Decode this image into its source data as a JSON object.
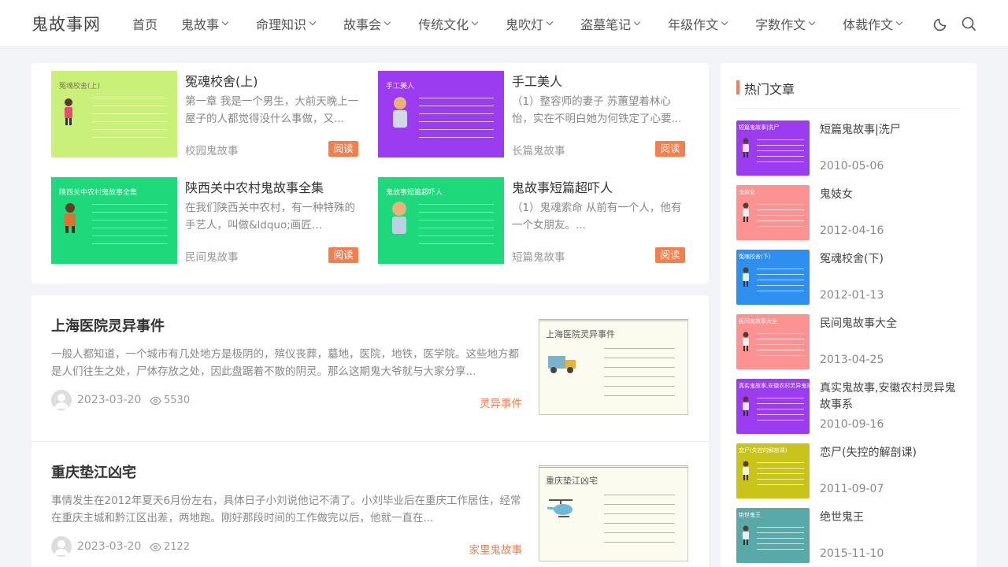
{
  "site": {
    "logo": "鬼故事网",
    "nav": [
      {
        "label": "首页",
        "dropdown": false
      },
      {
        "label": "鬼故事",
        "dropdown": true
      },
      {
        "label": "命理知识",
        "dropdown": true
      },
      {
        "label": "故事会",
        "dropdown": true
      },
      {
        "label": "传统文化",
        "dropdown": true
      },
      {
        "label": "鬼吹灯",
        "dropdown": true
      },
      {
        "label": "盗墓笔记",
        "dropdown": true
      },
      {
        "label": "年级作文",
        "dropdown": true
      },
      {
        "label": "字数作文",
        "dropdown": true
      },
      {
        "label": "体裁作文",
        "dropdown": true
      }
    ],
    "icons": {
      "theme": "moon-icon",
      "search": "search-icon"
    }
  },
  "featured": [
    {
      "thumb_title": "冤魂校舍(上)",
      "thumb_color": "#c9f17a",
      "title": "冤魂校舍(上)",
      "excerpt": "第一章 我是一个男生，大前天晚上一屋子的人都觉得没什么事做，又...",
      "category": "校园鬼故事",
      "read": "阅读"
    },
    {
      "thumb_title": "手工美人",
      "thumb_color": "#9b3cf1",
      "title": "手工美人",
      "excerpt": "（1）整容师的妻子 苏蕙望着林心怡，实在不明白她为何铁定了心要...",
      "category": "长篇鬼故事",
      "read": "阅读"
    },
    {
      "thumb_title": "陕西关中农村鬼故事全集",
      "thumb_color": "#1ed87c",
      "title": "陕西关中农村鬼故事全集",
      "excerpt": "在我们陕西关中农村，有一种特殊的手艺人，叫做&ldquo;画匠&rdquo;...",
      "category": "民间鬼故事",
      "read": "阅读"
    },
    {
      "thumb_title": "鬼故事短篇超吓人",
      "thumb_color": "#1ed87c",
      "title": "鬼故事短篇超吓人",
      "excerpt": "（1）鬼魂索命 从前有一个人，他有一个女朋友。...",
      "category": "短篇鬼故事",
      "read": "阅读"
    }
  ],
  "posts": [
    {
      "title": "上海医院灵异事件",
      "excerpt": "一般人都知道，一个城市有几处地方是极阴的，殡仪丧葬，墓地，医院，地铁，医学院。这些地方都是人们往生之处，尸体存放之处，因此盘踞着不散的阴灵。那么这期鬼大爷就与大家分享...",
      "date": "2023-03-20",
      "views": "5530",
      "category": "灵异事件",
      "thumb_title": "上海医院灵异事件",
      "thumb_icon": "truck-icon"
    },
    {
      "title": "重庆垫江凶宅",
      "excerpt": "事情发生在2012年夏天6月份左右，具体日子小刘说他记不清了。小刘毕业后在重庆工作居住，经常在重庆主城和黔江区出差，两地跑。刚好那段时间的工作做完以后，他就一直在...",
      "date": "2023-03-20",
      "views": "2122",
      "category": "家里鬼故事",
      "thumb_title": "重庆垫江凶宅",
      "thumb_icon": "helicopter-icon"
    }
  ],
  "sidebar": {
    "heading": "热门文章",
    "items": [
      {
        "title": "短篇鬼故事|洗尸",
        "date": "2010-05-06",
        "thumb_title": "短篇鬼故事|洗尸",
        "color": "#9b3cf1"
      },
      {
        "title": "鬼妓女",
        "date": "2012-04-16",
        "thumb_title": "鬼妓女",
        "color": "#fd9292"
      },
      {
        "title": "冤魂校舍(下)",
        "date": "2012-01-13",
        "thumb_title": "冤魂校舍(下)",
        "color": "#2f8ff0"
      },
      {
        "title": "民间鬼故事大全",
        "date": "2013-04-25",
        "thumb_title": "民间鬼故事大全",
        "color": "#fd9292"
      },
      {
        "title": "真实鬼故事,安徽农村灵异鬼故事系",
        "date": "2010-09-16",
        "thumb_title": "真实鬼故事,安徽农村灵异鬼故事系",
        "color": "#9b3cf1"
      },
      {
        "title": "恋尸(失控的解剖课)",
        "date": "2011-09-07",
        "thumb_title": "恋尸(失控的解剖课)",
        "color": "#c8c41a"
      },
      {
        "title": "绝世鬼王",
        "date": "2015-11-10",
        "thumb_title": "绝世鬼王",
        "color": "#5aa9a9"
      }
    ]
  }
}
